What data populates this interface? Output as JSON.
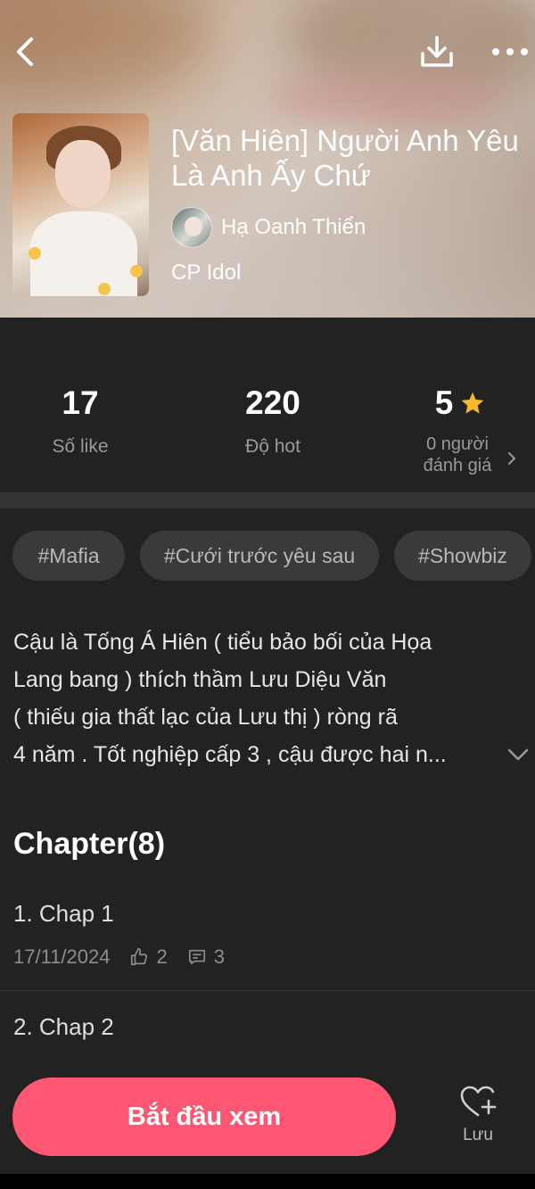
{
  "header": {
    "title": "[Văn Hiên] Người Anh Yêu Là Anh Ấy Chứ",
    "author_name": "Hạ Oanh Thiển",
    "category": "CP Idol",
    "icons": [
      "back-icon",
      "download-icon",
      "more-icon"
    ]
  },
  "stats": {
    "likes": {
      "value": "17",
      "label": "Số like"
    },
    "hot": {
      "value": "220",
      "label": "Độ hot"
    },
    "rating": {
      "value": "5",
      "label_line1": "0 người",
      "label_line2": "đánh giá",
      "star_color": "#f5b82e"
    }
  },
  "tags": [
    "#Mafia",
    "#Cưới trước yêu sau",
    "#Showbiz"
  ],
  "description": {
    "lines": [
      "Cậu là Tống Á Hiên ( tiểu bảo bối của Họa",
      "Lang bang ) thích thầm Lưu Diệu Văn",
      "( thiếu gia thất lạc của Lưu thị ) ròng rã",
      "4 năm . Tốt nghiệp cấp 3 , cậu được hai n..."
    ]
  },
  "chapters": {
    "heading": "Chapter(8)",
    "items": [
      {
        "title": "1. Chap 1",
        "date": "17/11/2024",
        "likes": "2",
        "comments": "3"
      },
      {
        "title": "2. Chap 2"
      }
    ]
  },
  "bottom_bar": {
    "start_label": "Bắt đầu xem",
    "save_label": "Lưu",
    "accent": "#ff5773"
  }
}
